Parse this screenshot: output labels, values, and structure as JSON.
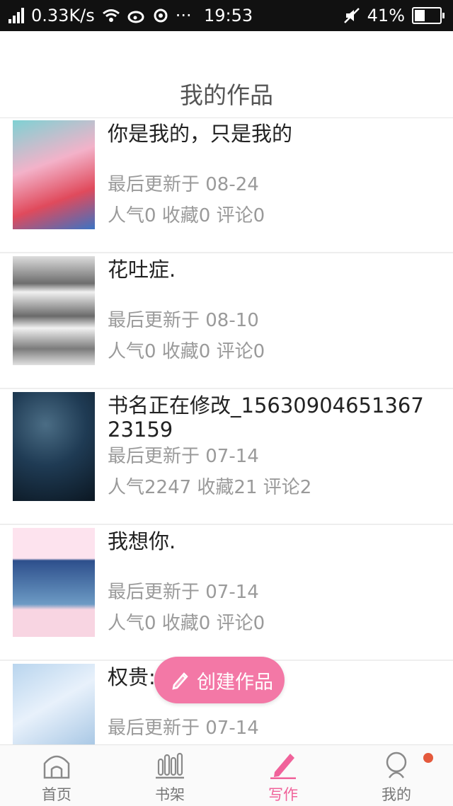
{
  "status_bar": {
    "speed": "0.33K/s",
    "more": "···",
    "time": "19:53",
    "battery": "41%",
    "battery_level": 0.41
  },
  "header": {
    "title": "我的作品"
  },
  "works": [
    {
      "name": "你是我的，只是我的",
      "updated": "最后更新于 08-24",
      "stats": "人气0 收藏0 评论0"
    },
    {
      "name": "花吐症.",
      "updated": "最后更新于 08-10",
      "stats": "人气0 收藏0 评论0"
    },
    {
      "name": "书名正在修改_1563090465136723159",
      "updated": "最后更新于 07-14",
      "stats": "人气2247 收藏21 评论2"
    },
    {
      "name": "我想你.",
      "updated": "最后更新于 07-14",
      "stats": "人气0 收藏0 评论0"
    },
    {
      "name": "权贵:",
      "updated": "最后更新于 07-14",
      "stats": ""
    }
  ],
  "fab": {
    "label": "创建作品",
    "icon": "pencil-icon"
  },
  "tabs": [
    {
      "label": "首页",
      "icon": "home-icon"
    },
    {
      "label": "书架",
      "icon": "bookshelf-icon"
    },
    {
      "label": "写作",
      "icon": "pen-icon"
    },
    {
      "label": "我的",
      "icon": "profile-icon"
    }
  ],
  "colors": {
    "accent": "#f0629a",
    "fab": "#f378a6",
    "badge": "#e4593c"
  }
}
